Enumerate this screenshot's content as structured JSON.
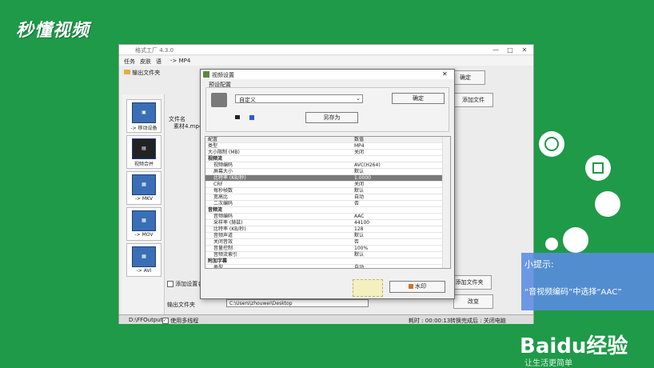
{
  "watermark": {
    "logo_text": "秒懂视频"
  },
  "app": {
    "title": "格式工厂 4.3.0",
    "menu": [
      "任务",
      "皮肤",
      "语"
    ],
    "toolbar_breadcrumb": "-> MP4",
    "output_label": "输出文件夹",
    "file_list_header": "文件名",
    "file_item": "素材4.mp4",
    "sidebar": [
      "-> 移动设备",
      "视频合并",
      "-> MKV",
      "-> MOV",
      "-> AVI"
    ],
    "right_buttons": [
      "确定",
      "添加文件",
      "添加文件夹",
      "改变"
    ],
    "add_settings_label": "添加设置名",
    "output_folder_label": "输出文件夹",
    "output_path": "C:\\Users\\zhouwei\\Desktop",
    "status_path": "D:\\FFOutput",
    "status_multithread": "使用多线程",
    "status_elapsed": "耗时 : 00:00:13",
    "status_after": "转换完成后 : 关闭电脑",
    "win_min": "—",
    "win_max": "□",
    "win_close": "✕"
  },
  "dialog": {
    "title": "视频设置",
    "preset_group_label": "预设配置",
    "preset_value": "自定义",
    "ok_label": "确定",
    "saveas_label": "另存为",
    "watermark_label": "水印",
    "close_label": "✕",
    "grid": {
      "headers": [
        "配置",
        "数值"
      ],
      "rows": [
        {
          "name": "类型",
          "value": "MP4",
          "kind": "item"
        },
        {
          "name": "大小限制 (MB)",
          "value": "关闭",
          "kind": "item"
        },
        {
          "name": "视频流",
          "value": "",
          "kind": "section"
        },
        {
          "name": "视频编码",
          "value": "AVC(H264)",
          "kind": "sub"
        },
        {
          "name": "屏幕大小",
          "value": "默认",
          "kind": "sub"
        },
        {
          "name": "比特率 (KB/秒)",
          "value": "1.0000",
          "kind": "selected"
        },
        {
          "name": "CRF",
          "value": "关闭",
          "kind": "sub"
        },
        {
          "name": "每秒帧数",
          "value": "默认",
          "kind": "sub"
        },
        {
          "name": "宽高比",
          "value": "自动",
          "kind": "sub"
        },
        {
          "name": "二次编码",
          "value": "否",
          "kind": "sub"
        },
        {
          "name": "音频流",
          "value": "",
          "kind": "section"
        },
        {
          "name": "音频编码",
          "value": "AAC",
          "kind": "sub"
        },
        {
          "name": "采样率 (赫兹)",
          "value": "44100",
          "kind": "sub"
        },
        {
          "name": "比特率 (KB/秒)",
          "value": "128",
          "kind": "sub"
        },
        {
          "name": "音频声道",
          "value": "默认",
          "kind": "sub"
        },
        {
          "name": "关闭音效",
          "value": "否",
          "kind": "sub"
        },
        {
          "name": "音量控制",
          "value": "100%",
          "kind": "sub"
        },
        {
          "name": "音频流索引",
          "value": "默认",
          "kind": "sub"
        },
        {
          "name": "附加字幕",
          "value": "",
          "kind": "section"
        },
        {
          "name": "类型",
          "value": "自动",
          "kind": "sub"
        }
      ]
    }
  },
  "tip": {
    "title": "小提示:",
    "body": "“音视频编码”中选择“AAC”"
  },
  "branding": {
    "baidu": "Baidu经验",
    "bottom": "让生活更简单"
  },
  "colors": {
    "background": "#1e9a48",
    "tip_panel": "#5a8ce1",
    "selected_row": "#7a7a7a"
  }
}
